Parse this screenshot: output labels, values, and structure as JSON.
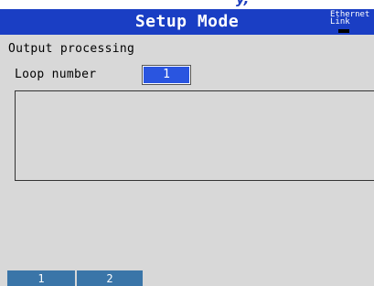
{
  "header": {
    "title": "Setup Mode",
    "ethernet_line1": "Ethernet",
    "ethernet_line2": "Link"
  },
  "main": {
    "section_title": "Output processing",
    "loop_number_label": "Loop number",
    "loop_number_value": "1"
  },
  "softkeys": [
    {
      "label": "1"
    },
    {
      "label": "2"
    }
  ],
  "colors": {
    "title_bar": "#1a3ec4",
    "selected_field": "#2a55e0",
    "softkey": "#3a75a8",
    "background": "#d8d8d8"
  }
}
